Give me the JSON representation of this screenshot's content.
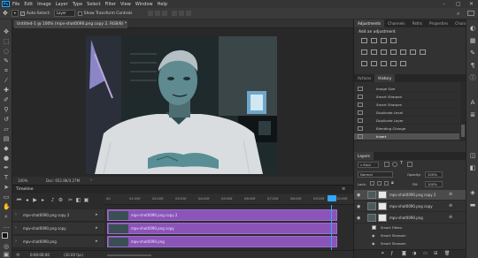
{
  "menubar": {
    "logo": "Ps",
    "items": [
      "File",
      "Edit",
      "Image",
      "Layer",
      "Type",
      "Select",
      "Filter",
      "View",
      "Window",
      "Help"
    ],
    "window_controls": [
      "–",
      "▢",
      "✕"
    ]
  },
  "options": {
    "auto_select_label": "Auto-Select:",
    "auto_select_value": "Layer",
    "show_transform_label": "Show Transform Controls"
  },
  "document": {
    "tab_title": "Untitled-1 @ 100% (mpv-shot0090.png copy 2, RGB/8) *",
    "zoom": "100%",
    "doc_size": "Doc: 652.8K/3.27M"
  },
  "timeline": {
    "title": "Timeline",
    "ruler_labels": [
      "00",
      "01:00f",
      "02:00f",
      "03:00f",
      "04:00f",
      "05:00f",
      "06:00f",
      "07:00f",
      "08:00f",
      "09:00f",
      "10:00f"
    ],
    "time_readout": "0:00:00:00",
    "fps": "(30.00 fps)",
    "tracks": [
      {
        "label": "mpv-shot0090.png copy 2",
        "clip": "mpv-shot0090.png copy 2"
      },
      {
        "label": "mpv-shot0090.png copy",
        "clip": "mpv-shot0090.png copy"
      },
      {
        "label": "mpv-shot0090.png",
        "clip": "mpv-shot0090.png"
      }
    ]
  },
  "adjustments": {
    "tabs": [
      "Adjustments",
      "Channels",
      "Paths",
      "Properties",
      "Character"
    ],
    "heading": "Add an adjustment"
  },
  "history": {
    "tabs": [
      "Actions",
      "History"
    ],
    "items": [
      "Image Size",
      "Smart Sharpen",
      "Smart Sharpen",
      "Duplicate Level",
      "Duplicate Layer",
      "Blending Change",
      "Invert"
    ]
  },
  "layers": {
    "tab": "Layers",
    "kind_label": "Kind",
    "blend_mode": "Normal",
    "opacity_label": "Opacity:",
    "opacity_value": "100%",
    "lock_label": "Lock:",
    "fill_label": "Fill:",
    "fill_value": "100%",
    "rows": [
      {
        "name": "mpv-shot0090.png copy 2"
      },
      {
        "name": "mpv-shot0090.png copy"
      },
      {
        "name": "mpv-shot0090.png"
      }
    ],
    "sub_rows": [
      "Smart Filters",
      "Smart Sharpen",
      "Smart Sharpen"
    ]
  },
  "colors": {
    "clip_purple": "#8a54b8",
    "panel_bg": "#323232",
    "accent_blue": "#31a8ff"
  }
}
